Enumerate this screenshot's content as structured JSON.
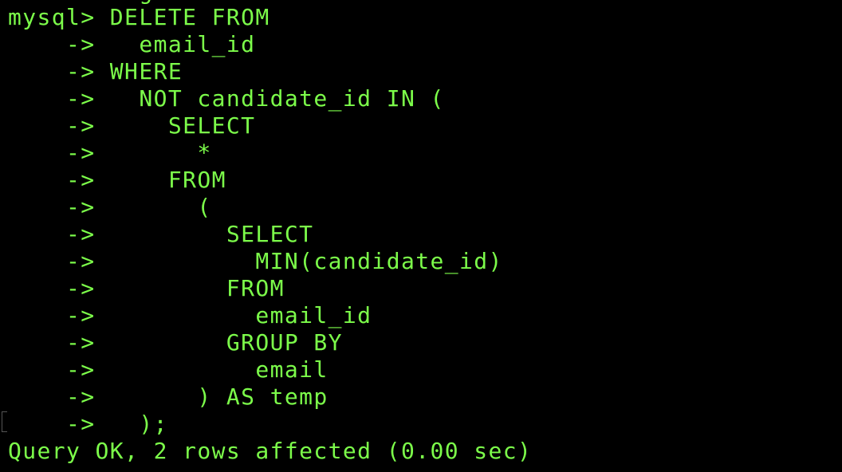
{
  "colors": {
    "background": "#000000",
    "text": "#7CFC4A"
  },
  "terminal": {
    "clipped_top": "         g",
    "lines": [
      "mysql> DELETE FROM",
      "    ->   email_id",
      "    -> WHERE",
      "    ->   NOT candidate_id IN (",
      "    ->     SELECT",
      "    ->       *",
      "    ->     FROM",
      "    ->       (",
      "    ->         SELECT",
      "    ->           MIN(candidate_id)",
      "    ->         FROM",
      "    ->           email_id",
      "    ->         GROUP BY",
      "    ->           email",
      "    ->       ) AS temp",
      "    ->   );"
    ],
    "result": "Query OK, 2 rows affected (0.00 sec)"
  }
}
